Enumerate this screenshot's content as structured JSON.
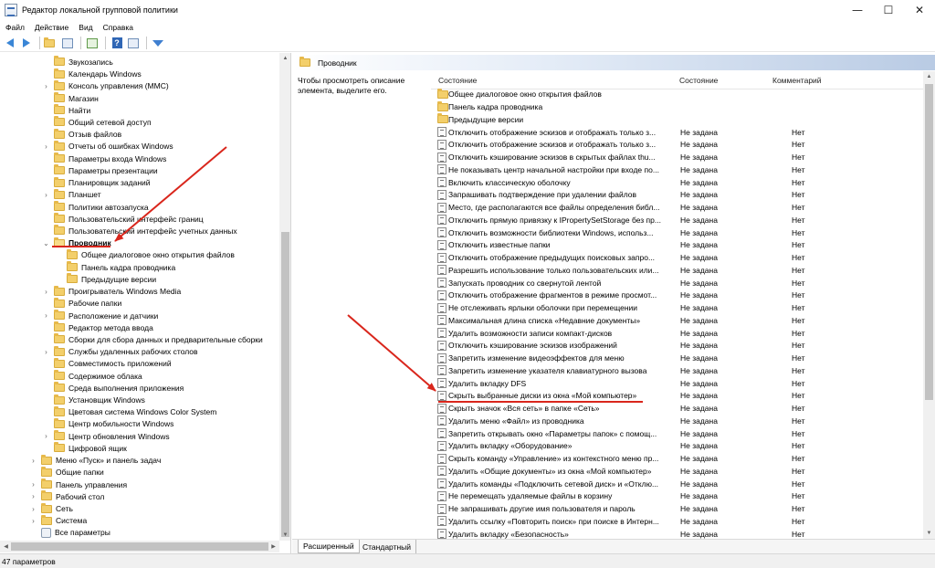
{
  "window": {
    "title": "Редактор локальной групповой политики",
    "minimize_glyph": "—",
    "maximize_glyph": "☐",
    "close_glyph": "✕"
  },
  "menu": [
    "Файл",
    "Действие",
    "Вид",
    "Справка"
  ],
  "toolbar": {
    "icons": [
      "back-arrow-icon",
      "forward-arrow-icon",
      "folder-up-icon",
      "show-hide-tree-icon",
      "export-list-icon",
      "help-icon",
      "properties-icon",
      "filter-icon"
    ]
  },
  "tree": {
    "items": [
      {
        "label": "Звукозапись",
        "level": 1,
        "expand": "",
        "icon": "folder"
      },
      {
        "label": "Календарь Windows",
        "level": 1,
        "expand": "",
        "icon": "folder"
      },
      {
        "label": "Консоль управления (MMC)",
        "level": 1,
        "expand": "›",
        "icon": "folder"
      },
      {
        "label": "Магазин",
        "level": 1,
        "expand": "",
        "icon": "folder"
      },
      {
        "label": "Найти",
        "level": 1,
        "expand": "",
        "icon": "folder"
      },
      {
        "label": "Общий сетевой доступ",
        "level": 1,
        "expand": "",
        "icon": "folder"
      },
      {
        "label": "Отзыв файлов",
        "level": 1,
        "expand": "",
        "icon": "folder"
      },
      {
        "label": "Отчеты об ошибках Windows",
        "level": 1,
        "expand": "›",
        "icon": "folder"
      },
      {
        "label": "Параметры входа Windows",
        "level": 1,
        "expand": "",
        "icon": "folder"
      },
      {
        "label": "Параметры презентации",
        "level": 1,
        "expand": "",
        "icon": "folder"
      },
      {
        "label": "Планировщик заданий",
        "level": 1,
        "expand": "",
        "icon": "folder"
      },
      {
        "label": "Планшет",
        "level": 1,
        "expand": "›",
        "icon": "folder"
      },
      {
        "label": "Политики автозапуска",
        "level": 1,
        "expand": "",
        "icon": "folder"
      },
      {
        "label": "Пользовательский интерфейс границ",
        "level": 1,
        "expand": "",
        "icon": "folder"
      },
      {
        "label": "Пользовательский интерфейс учетных данных",
        "level": 1,
        "expand": "",
        "icon": "folder"
      },
      {
        "label": "Проводник",
        "level": 1,
        "expand": "⌄",
        "icon": "folder-open",
        "selected": true
      },
      {
        "label": "Общее диалоговое окно открытия файлов",
        "level": 2,
        "expand": "",
        "icon": "folder"
      },
      {
        "label": "Панель кадра проводника",
        "level": 2,
        "expand": "",
        "icon": "folder"
      },
      {
        "label": "Предыдущие версии",
        "level": 2,
        "expand": "",
        "icon": "folder"
      },
      {
        "label": "Проигрыватель Windows Media",
        "level": 1,
        "expand": "›",
        "icon": "folder"
      },
      {
        "label": "Рабочие папки",
        "level": 1,
        "expand": "",
        "icon": "folder"
      },
      {
        "label": "Расположение и датчики",
        "level": 1,
        "expand": "›",
        "icon": "folder"
      },
      {
        "label": "Редактор метода ввода",
        "level": 1,
        "expand": "",
        "icon": "folder"
      },
      {
        "label": "Сборки для сбора данных и предварительные сборки",
        "level": 1,
        "expand": "",
        "icon": "folder"
      },
      {
        "label": "Службы удаленных рабочих столов",
        "level": 1,
        "expand": "›",
        "icon": "folder"
      },
      {
        "label": "Совместимость приложений",
        "level": 1,
        "expand": "",
        "icon": "folder"
      },
      {
        "label": "Содержимое облака",
        "level": 1,
        "expand": "",
        "icon": "folder"
      },
      {
        "label": "Среда выполнения приложения",
        "level": 1,
        "expand": "",
        "icon": "folder"
      },
      {
        "label": "Установщик Windows",
        "level": 1,
        "expand": "",
        "icon": "folder"
      },
      {
        "label": "Цветовая система Windows Color System",
        "level": 1,
        "expand": "",
        "icon": "folder"
      },
      {
        "label": "Центр мобильности Windows",
        "level": 1,
        "expand": "",
        "icon": "folder"
      },
      {
        "label": "Центр обновления Windows",
        "level": 1,
        "expand": "›",
        "icon": "folder"
      },
      {
        "label": "Цифровой ящик",
        "level": 1,
        "expand": "",
        "icon": "folder"
      },
      {
        "label": "Меню «Пуск» и панель задач",
        "level": 0,
        "expand": "›",
        "icon": "folder"
      },
      {
        "label": "Общие папки",
        "level": 0,
        "expand": "",
        "icon": "folder"
      },
      {
        "label": "Панель управления",
        "level": 0,
        "expand": "›",
        "icon": "folder"
      },
      {
        "label": "Рабочий стол",
        "level": 0,
        "expand": "›",
        "icon": "folder"
      },
      {
        "label": "Сеть",
        "level": 0,
        "expand": "›",
        "icon": "folder"
      },
      {
        "label": "Система",
        "level": 0,
        "expand": "›",
        "icon": "folder"
      },
      {
        "label": "Все параметры",
        "level": 0,
        "expand": "",
        "icon": "gear"
      }
    ]
  },
  "right": {
    "header_title": "Проводник",
    "description": "Чтобы просмотреть описание элемента, выделите его.",
    "columns": {
      "name": "Состояние",
      "state": "Состояние",
      "comment": "Комментарий"
    },
    "rows": [
      {
        "name": "Общее диалоговое окно открытия файлов",
        "state": "",
        "comment": "",
        "icon": "folder"
      },
      {
        "name": "Панель кадра проводника",
        "state": "",
        "comment": "",
        "icon": "folder"
      },
      {
        "name": "Предыдущие версии",
        "state": "",
        "comment": "",
        "icon": "folder"
      },
      {
        "name": "Отключить отображение эскизов и отображать только з...",
        "state": "Не задана",
        "comment": "Нет",
        "icon": "setting"
      },
      {
        "name": "Отключить отображение эскизов и отображать только з...",
        "state": "Не задана",
        "comment": "Нет",
        "icon": "setting"
      },
      {
        "name": "Отключить кэширование эскизов в скрытых файлах thu...",
        "state": "Не задана",
        "comment": "Нет",
        "icon": "setting"
      },
      {
        "name": "Не показывать центр начальной настройки при входе по...",
        "state": "Не задана",
        "comment": "Нет",
        "icon": "setting"
      },
      {
        "name": "Включить классическую оболочку",
        "state": "Не задана",
        "comment": "Нет",
        "icon": "setting"
      },
      {
        "name": "Запрашивать подтверждение при удалении файлов",
        "state": "Не задана",
        "comment": "Нет",
        "icon": "setting"
      },
      {
        "name": "Место, где располагаются все файлы определения библ...",
        "state": "Не задана",
        "comment": "Нет",
        "icon": "setting"
      },
      {
        "name": "Отключить прямую привязку к IPropertySetStorage без пр...",
        "state": "Не задана",
        "comment": "Нет",
        "icon": "setting"
      },
      {
        "name": "Отключить возможности библиотеки Windows, использ...",
        "state": "Не задана",
        "comment": "Нет",
        "icon": "setting"
      },
      {
        "name": "Отключить известные папки",
        "state": "Не задана",
        "comment": "Нет",
        "icon": "setting"
      },
      {
        "name": "Отключить отображение предыдущих поисковых запро...",
        "state": "Не задана",
        "comment": "Нет",
        "icon": "setting"
      },
      {
        "name": "Разрешить использование только пользовательских или...",
        "state": "Не задана",
        "comment": "Нет",
        "icon": "setting"
      },
      {
        "name": "Запускать проводник со свернутой лентой",
        "state": "Не задана",
        "comment": "Нет",
        "icon": "setting"
      },
      {
        "name": "Отключить отображение фрагментов в режиме просмот...",
        "state": "Не задана",
        "comment": "Нет",
        "icon": "setting"
      },
      {
        "name": "Не отслеживать ярлыки оболочки при перемещении",
        "state": "Не задана",
        "comment": "Нет",
        "icon": "setting"
      },
      {
        "name": "Максимальная длина списка «Недавние документы»",
        "state": "Не задана",
        "comment": "Нет",
        "icon": "setting"
      },
      {
        "name": "Удалить возможности записи компакт-дисков",
        "state": "Не задана",
        "comment": "Нет",
        "icon": "setting"
      },
      {
        "name": "Отключить кэширование эскизов изображений",
        "state": "Не задана",
        "comment": "Нет",
        "icon": "setting"
      },
      {
        "name": "Запретить изменение видеоэффектов для меню",
        "state": "Не задана",
        "comment": "Нет",
        "icon": "setting"
      },
      {
        "name": "Запретить изменение указателя клавиатурного вызова",
        "state": "Не задана",
        "comment": "Нет",
        "icon": "setting"
      },
      {
        "name": "Удалить вкладку DFS",
        "state": "Не задана",
        "comment": "Нет",
        "icon": "setting"
      },
      {
        "name": "Скрыть выбранные диски из окна «Мой компьютер»",
        "state": "Не задана",
        "comment": "Нет",
        "icon": "setting",
        "highlight": true
      },
      {
        "name": "Скрыть значок «Вся сеть» в папке «Сеть»",
        "state": "Не задана",
        "comment": "Нет",
        "icon": "setting"
      },
      {
        "name": "Удалить меню «Файл» из проводника",
        "state": "Не задана",
        "comment": "Нет",
        "icon": "setting"
      },
      {
        "name": "Запретить открывать окно «Параметры папок» с помощ...",
        "state": "Не задана",
        "comment": "Нет",
        "icon": "setting"
      },
      {
        "name": "Удалить вкладку «Оборудование»",
        "state": "Не задана",
        "comment": "Нет",
        "icon": "setting"
      },
      {
        "name": "Скрыть команду «Управление» из контекстного меню пр...",
        "state": "Не задана",
        "comment": "Нет",
        "icon": "setting"
      },
      {
        "name": "Удалить «Общие документы» из окна «Мой компьютер»",
        "state": "Не задана",
        "comment": "Нет",
        "icon": "setting"
      },
      {
        "name": "Удалить команды «Подключить сетевой диск» и «Отклю...",
        "state": "Не задана",
        "comment": "Нет",
        "icon": "setting"
      },
      {
        "name": "Не перемещать удаляемые файлы в корзину",
        "state": "Не задана",
        "comment": "Нет",
        "icon": "setting"
      },
      {
        "name": "Не запрашивать другие имя пользователя и пароль",
        "state": "Не задана",
        "comment": "Нет",
        "icon": "setting"
      },
      {
        "name": "Удалить ссылку «Повторить поиск» при поиске в Интерн...",
        "state": "Не задана",
        "comment": "Нет",
        "icon": "setting"
      },
      {
        "name": "Удалить вкладку «Безопасность»",
        "state": "Не задана",
        "comment": "Нет",
        "icon": "setting"
      }
    ]
  },
  "tabs": {
    "extended": "Расширенный",
    "standard": "Стандартный"
  },
  "status": {
    "text": "47 параметров"
  },
  "colors": {
    "annotation": "#d9261c",
    "accent": "#3a86d6",
    "folder": "#f3cf6b"
  }
}
